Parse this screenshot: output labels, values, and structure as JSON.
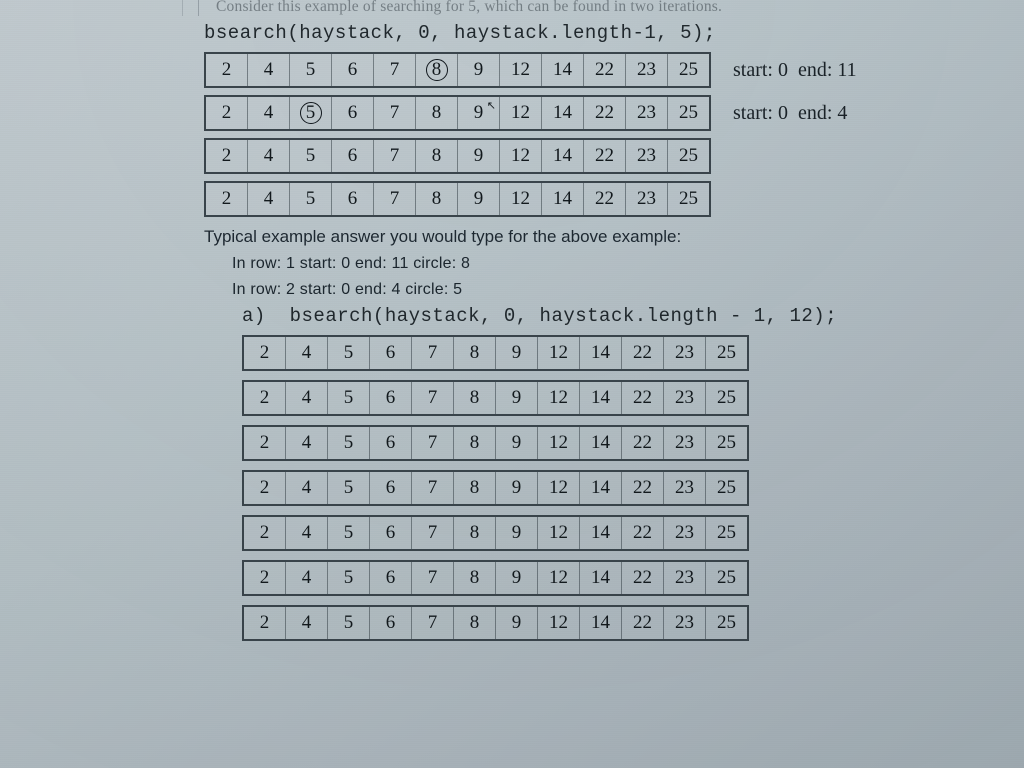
{
  "cut_line": "Consider this example of searching for 5, which can be found in two iterations.",
  "example": {
    "code": "bsearch(haystack, 0, haystack.length-1, 5);",
    "rows": [
      {
        "cells": [
          2,
          4,
          5,
          6,
          7,
          8,
          9,
          12,
          14,
          22,
          23,
          25
        ],
        "circle_index": 5,
        "anno": "start: 0  end: 11"
      },
      {
        "cells": [
          2,
          4,
          5,
          6,
          7,
          8,
          9,
          12,
          14,
          22,
          23,
          25
        ],
        "circle_index": 2,
        "cursor_index": 6,
        "anno": "start: 0  end: 4"
      },
      {
        "cells": [
          2,
          4,
          5,
          6,
          7,
          8,
          9,
          12,
          14,
          22,
          23,
          25
        ]
      },
      {
        "cells": [
          2,
          4,
          5,
          6,
          7,
          8,
          9,
          12,
          14,
          22,
          23,
          25
        ]
      }
    ]
  },
  "typical_label": "Typical example answer you would type for the above example:",
  "typical_answers": [
    "In row: 1   start: 0   end: 11   circle: 8",
    "In row: 2   start: 0   end: 4   circle: 5"
  ],
  "part_a": {
    "code": "a)  bsearch(haystack, 0, haystack.length - 1, 12);",
    "rows": [
      {
        "cells": [
          2,
          4,
          5,
          6,
          7,
          8,
          9,
          12,
          14,
          22,
          23,
          25
        ]
      },
      {
        "cells": [
          2,
          4,
          5,
          6,
          7,
          8,
          9,
          12,
          14,
          22,
          23,
          25
        ]
      },
      {
        "cells": [
          2,
          4,
          5,
          6,
          7,
          8,
          9,
          12,
          14,
          22,
          23,
          25
        ]
      },
      {
        "cells": [
          2,
          4,
          5,
          6,
          7,
          8,
          9,
          12,
          14,
          22,
          23,
          25
        ]
      },
      {
        "cells": [
          2,
          4,
          5,
          6,
          7,
          8,
          9,
          12,
          14,
          22,
          23,
          25
        ]
      },
      {
        "cells": [
          2,
          4,
          5,
          6,
          7,
          8,
          9,
          12,
          14,
          22,
          23,
          25
        ]
      },
      {
        "cells": [
          2,
          4,
          5,
          6,
          7,
          8,
          9,
          12,
          14,
          22,
          23,
          25
        ]
      }
    ]
  }
}
